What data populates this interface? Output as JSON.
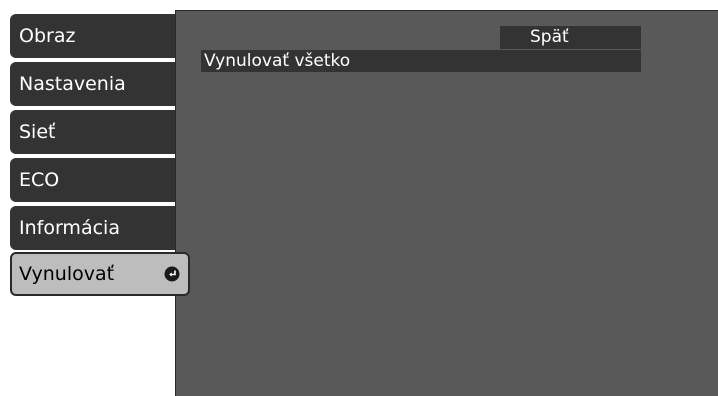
{
  "sidebar": {
    "items": [
      {
        "label": "Obraz"
      },
      {
        "label": "Nastavenia"
      },
      {
        "label": "Sieť"
      },
      {
        "label": "ECO"
      },
      {
        "label": "Informácia"
      },
      {
        "label": "Vynulovať",
        "icon": "enter-icon",
        "active": true
      }
    ]
  },
  "main": {
    "back_label": "Späť",
    "reset_all_label": "Vynulovať všetko"
  },
  "colors": {
    "panel": "#595959",
    "tab": "#333333",
    "active_tab": "#bdbdbd",
    "text": "#ffffff"
  }
}
